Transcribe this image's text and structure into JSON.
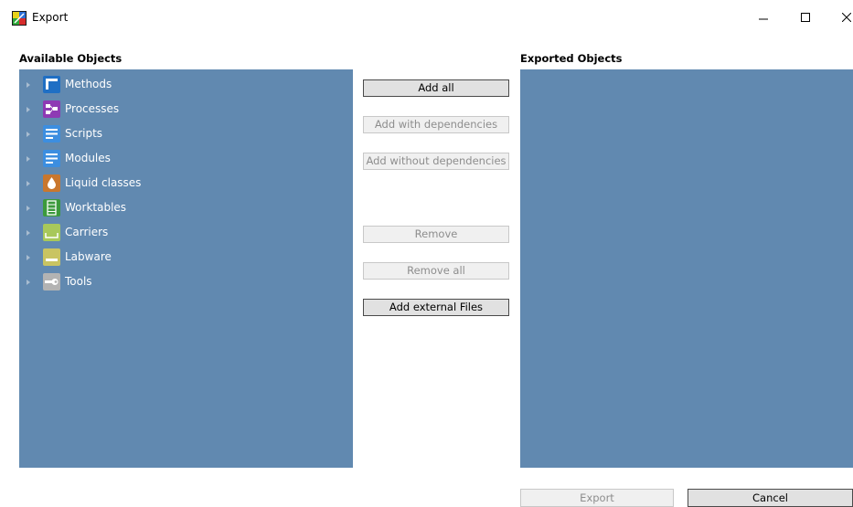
{
  "window": {
    "title": "Export",
    "icon": "app-multicolor-icon"
  },
  "left_panel": {
    "label": "Available Objects",
    "items": [
      {
        "label": "Methods",
        "icon": "methods-icon",
        "color": "#1f6fc4"
      },
      {
        "label": "Processes",
        "icon": "processes-icon",
        "color": "#8e3ab4"
      },
      {
        "label": "Scripts",
        "icon": "scripts-icon",
        "color": "#3c8ee0"
      },
      {
        "label": "Modules",
        "icon": "modules-icon",
        "color": "#3c8ee0"
      },
      {
        "label": "Liquid classes",
        "icon": "liquid-drop-icon",
        "color": "#c9772e"
      },
      {
        "label": "Worktables",
        "icon": "worktable-icon",
        "color": "#3c9a3c"
      },
      {
        "label": "Carriers",
        "icon": "carrier-icon",
        "color": "#a8c85a"
      },
      {
        "label": "Labware",
        "icon": "labware-icon",
        "color": "#c9c462"
      },
      {
        "label": "Tools",
        "icon": "tools-wrench-icon",
        "color": "#b3b3b3"
      }
    ]
  },
  "right_panel": {
    "label": "Exported Objects"
  },
  "actions": {
    "add_all": "Add all",
    "add_with_deps": "Add with dependencies",
    "add_without_deps": "Add without dependencies",
    "remove": "Remove",
    "remove_all": "Remove all",
    "add_external": "Add external Files"
  },
  "footer": {
    "export": "Export",
    "cancel": "Cancel"
  },
  "colors": {
    "panel_bg": "#6189b0",
    "button_bg": "#e1e1e1",
    "disabled_text": "#8d8d8d"
  }
}
